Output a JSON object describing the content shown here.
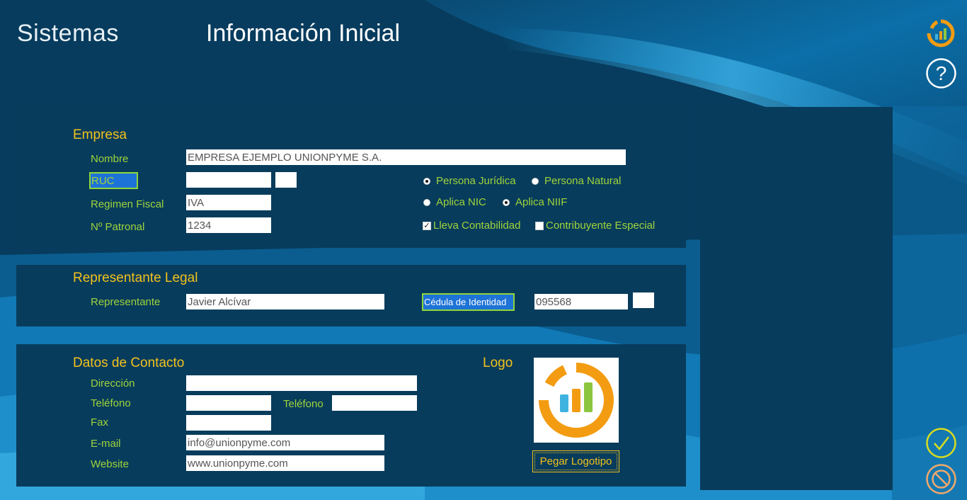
{
  "header": {
    "app_title": "Sistemas",
    "page_title": "Información Inicial"
  },
  "empresa": {
    "section_title": "Empresa",
    "nombre_label": "Nombre",
    "nombre_value": "EMPRESA EJEMPLO UNIONPYME S.A.",
    "ruc_label": "RUC",
    "ruc_value": "",
    "ruc_check_value": "",
    "regimen_label": "Regimen Fiscal",
    "regimen_value": "IVA",
    "patronal_label": "Nº Patronal",
    "patronal_value": "1234",
    "persona_juridica": "Persona Jurídica",
    "persona_natural": "Persona Natural",
    "aplica_nic": "Aplica NIC",
    "aplica_niif": "Aplica NIIF",
    "lleva_contabilidad": "Lleva Contabilidad",
    "contribuyente_especial": "Contribuyente Especial"
  },
  "representante": {
    "section_title": "Representante Legal",
    "representante_label": "Representante",
    "representante_value": "Javier Alcívar",
    "cedula_label": "Cédula de Identidad",
    "cedula_value": "095568",
    "cedula_check_value": ""
  },
  "contacto": {
    "section_title": "Datos de Contacto",
    "direccion_label": "Dirección",
    "direccion_value": "",
    "telefono_label": "Teléfono",
    "telefono_value": "",
    "telefono2_label": "Teléfono",
    "telefono2_value": "",
    "fax_label": "Fax",
    "fax_value": "",
    "email_label": "E-mail",
    "email_value": "info@unionpyme.com",
    "website_label": "Website",
    "website_value": "www.unionpyme.com",
    "logo_title": "Logo",
    "pegar_logo": "Pegar Logotipo"
  },
  "icons": {
    "brand": "brand-logo-icon",
    "help": "help-icon",
    "confirm": "check-circle-icon",
    "cancel": "cancel-circle-icon"
  },
  "colors": {
    "panel": "#083c5c",
    "section_title": "#f2c21b",
    "label": "#9ed43a",
    "logo_orange": "#f39c12"
  }
}
